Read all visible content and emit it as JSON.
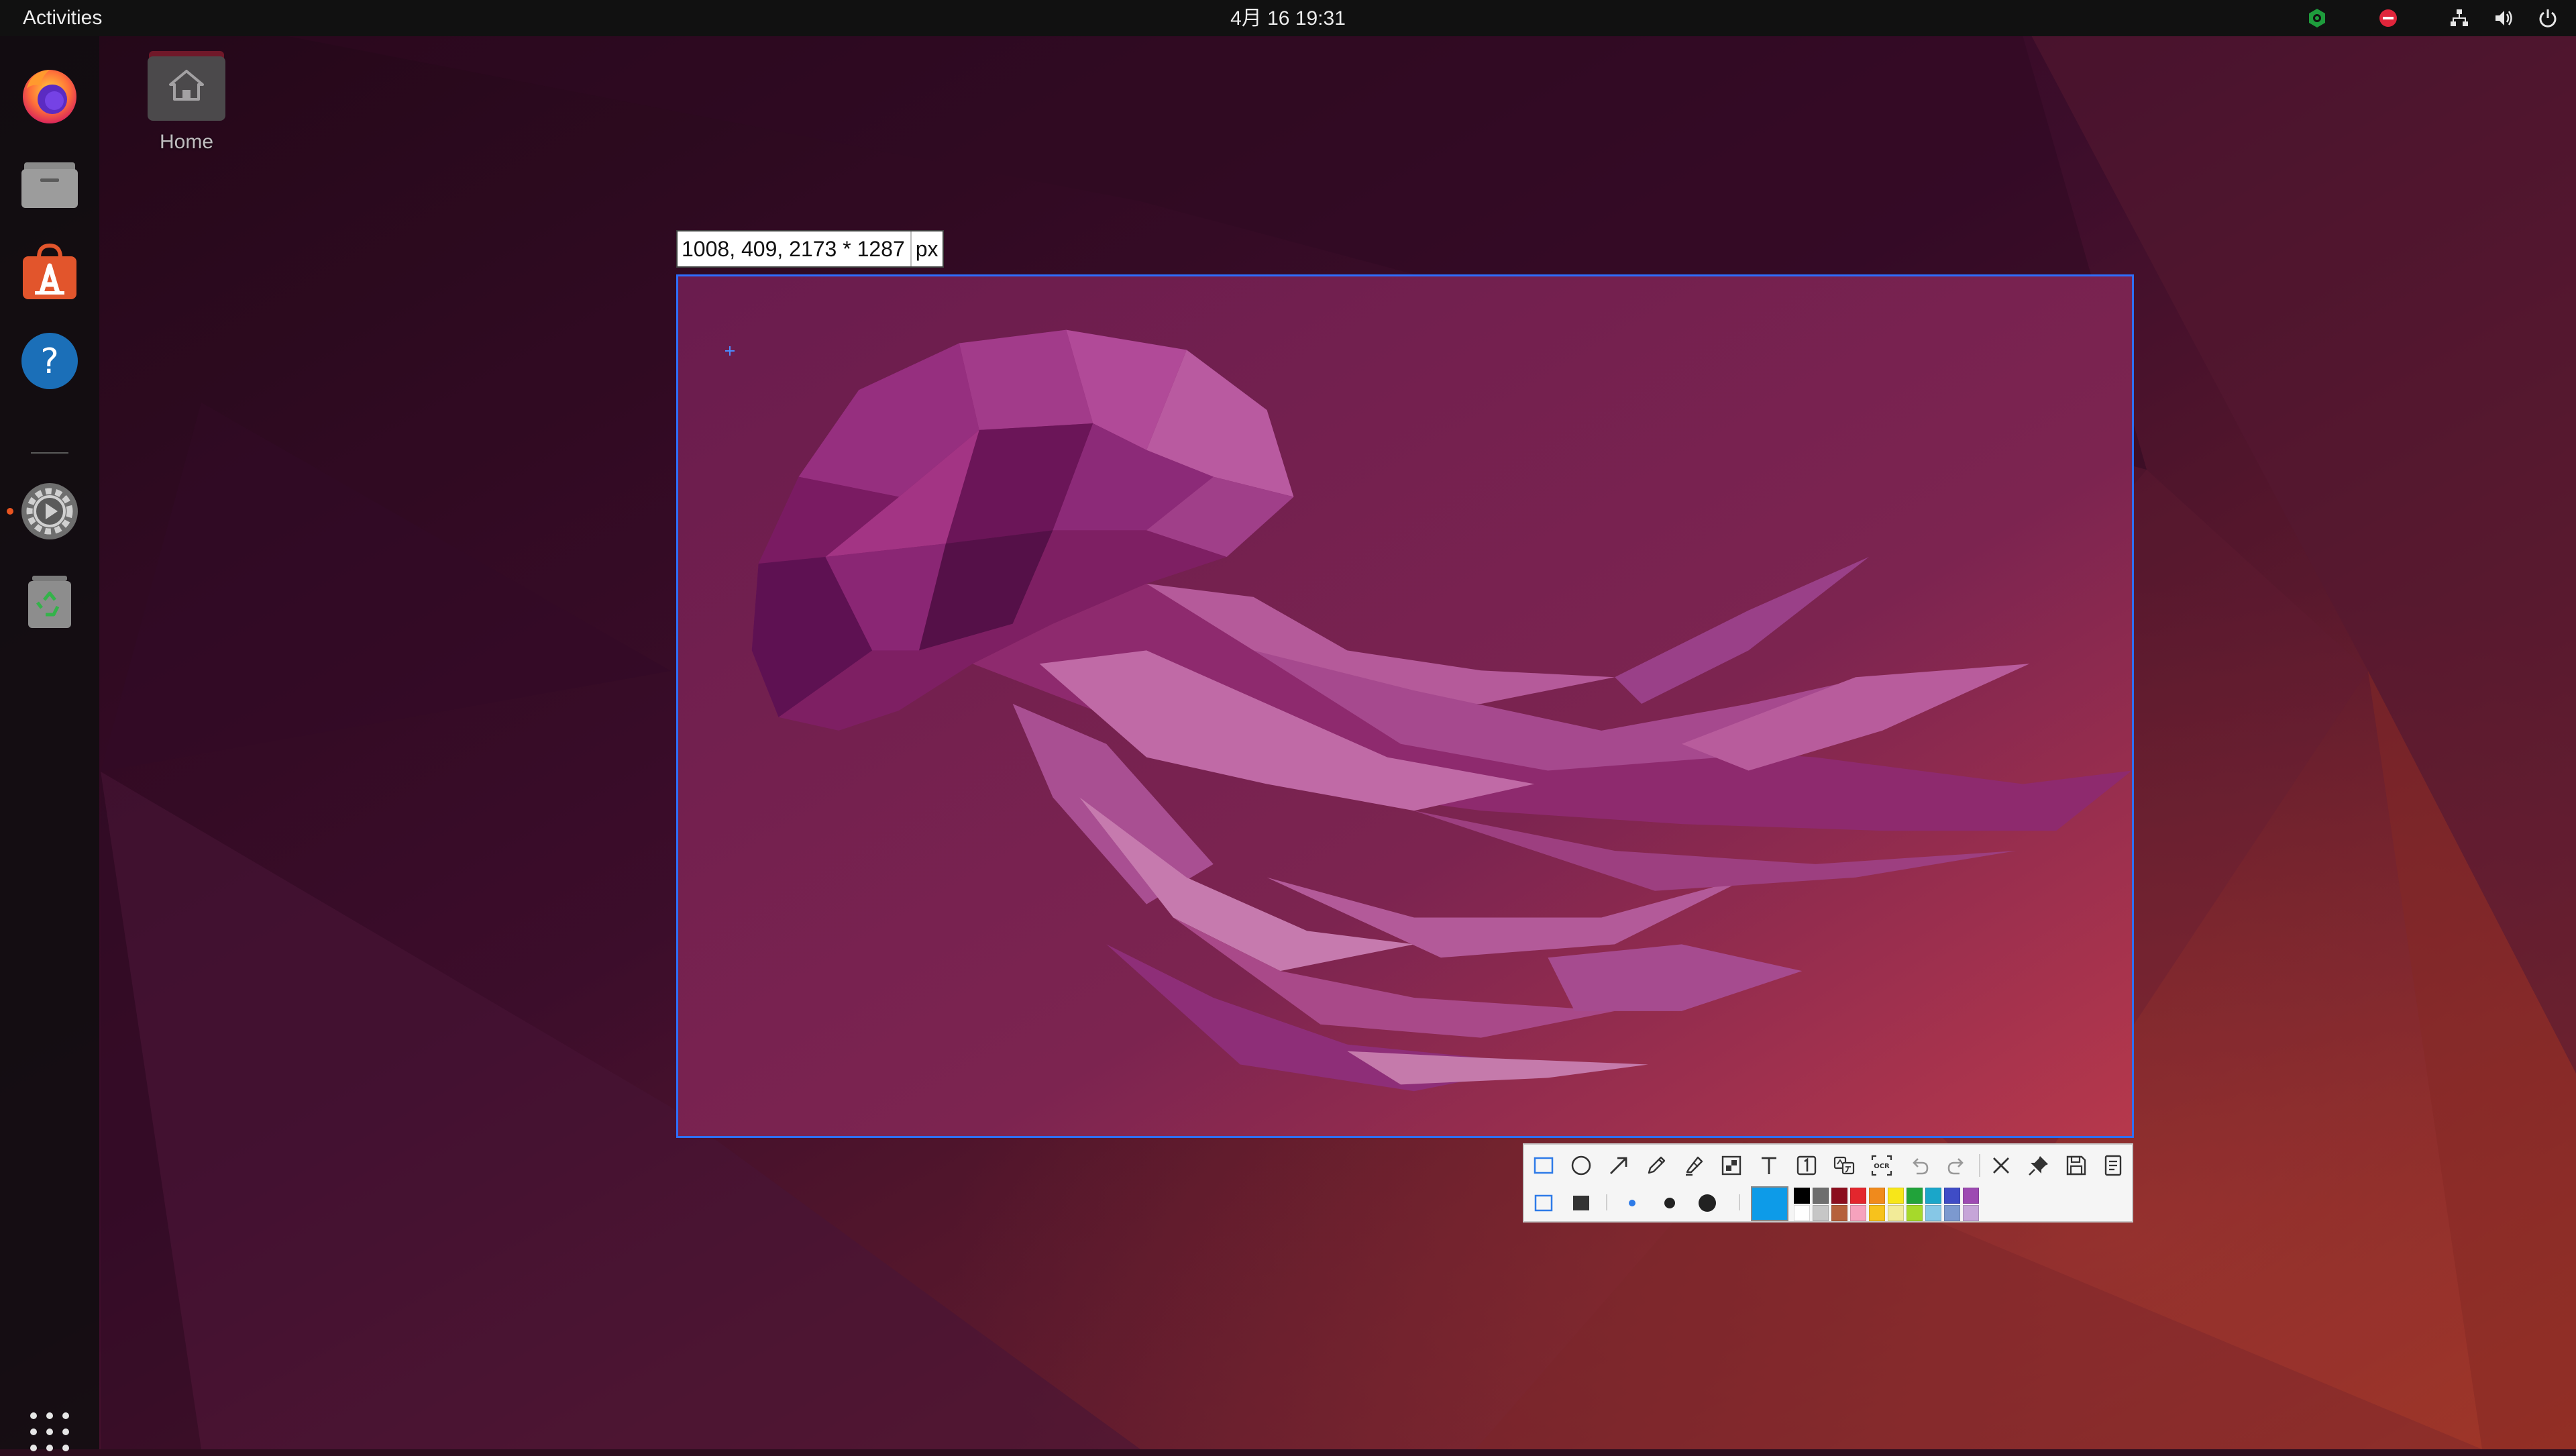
{
  "topbar": {
    "activities_label": "Activities",
    "clock": "4月 16  19:31",
    "tray_icons": [
      "app-indicator-icon",
      "do-not-disturb-icon",
      "network-icon",
      "volume-icon",
      "power-icon"
    ]
  },
  "dock": {
    "apps": [
      {
        "name": "firefox",
        "icon": "firefox-icon"
      },
      {
        "name": "files",
        "icon": "files-icon"
      },
      {
        "name": "software",
        "icon": "software-store-icon"
      },
      {
        "name": "help",
        "icon": "help-icon"
      },
      {
        "name": "settings",
        "icon": "settings-icon",
        "running": true
      },
      {
        "name": "trash",
        "icon": "trash-icon"
      }
    ],
    "show_apps_icon": "grid-icon"
  },
  "desktop": {
    "home_label": "Home"
  },
  "capture": {
    "size_readout": "1008, 409, 2173 * 1287",
    "size_unit": "px"
  },
  "toolbar": {
    "row1": [
      "rectangle-icon",
      "ellipse-icon",
      "arrow-icon",
      "pen-icon",
      "marker-icon",
      "mosaic-icon",
      "text-icon",
      "number-icon",
      "translate-icon",
      "ocr-icon",
      "undo-icon",
      "redo-icon",
      "cancel-icon",
      "pin-icon",
      "save-icon",
      "copy-icon"
    ],
    "current_color": "#0d9be8",
    "palette_top": [
      "#000000",
      "#6e6e6e",
      "#8b0e1e",
      "#e3262d",
      "#f08a1c",
      "#f7e619",
      "#21a33a",
      "#1aa6c9",
      "#3f4cc6",
      "#9d4ab2"
    ],
    "palette_bottom": [
      "#ffffff",
      "#c6c6c6",
      "#b5613c",
      "#f6a2bd",
      "#f7c21c",
      "#f2eb98",
      "#a6d92b",
      "#86c7e6",
      "#7c99cf",
      "#c6a5d8"
    ]
  }
}
